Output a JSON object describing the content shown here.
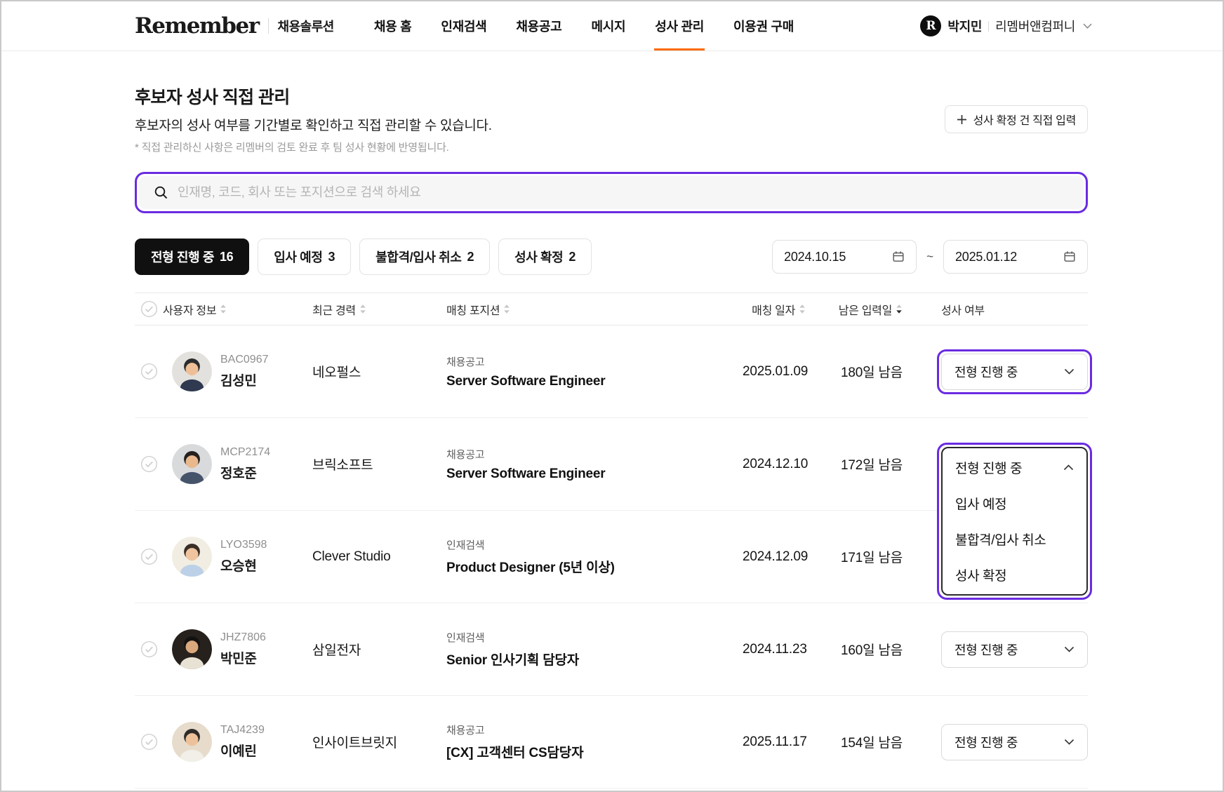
{
  "colors": {
    "accent": "#fa6b0a",
    "highlight": "#6a2be2"
  },
  "icons": {
    "search": "magnifier",
    "calendar": "calendar-range",
    "plus": "plus",
    "chevron_down": "chevron-down",
    "chevron_up": "chevron-up",
    "sort": "up-down-triangles",
    "row_check": "check-circle",
    "logo_mark": "R-circle"
  },
  "nav": {
    "logo": "Remember",
    "product": "채용솔루션",
    "items": [
      {
        "key": "home",
        "label": "채용 홈",
        "active": false
      },
      {
        "key": "talent-search",
        "label": "인재검색",
        "active": false
      },
      {
        "key": "job-postings",
        "label": "채용공고",
        "active": false
      },
      {
        "key": "messages",
        "label": "메시지",
        "active": false
      },
      {
        "key": "match-management",
        "label": "성사 관리",
        "active": true
      },
      {
        "key": "purchase-pass",
        "label": "이용권 구매",
        "active": false
      }
    ],
    "user": {
      "initial": "R",
      "name": "박지민",
      "company": "리멤버앤컴퍼니"
    }
  },
  "page": {
    "title": "후보자 성사 직접 관리",
    "subtitle": "후보자의 성사 여부를 기간별로 확인하고 직접 관리할 수 있습니다.",
    "note": "* 직접 관리하신 사항은 리멤버의 검토 완료 후 팀 성사 현황에 반영됩니다.",
    "add_button_label": "성사 확정 건 직접 입력"
  },
  "search": {
    "placeholder": "인재명, 코드, 회사 또는 포지션으로 검색 하세요"
  },
  "filters": [
    {
      "key": "in-progress",
      "label": "전형 진행 중",
      "count": "16",
      "active": true
    },
    {
      "key": "join-expected",
      "label": "입사 예정",
      "count": "3",
      "active": false
    },
    {
      "key": "rejected-cancelled",
      "label": "불합격/입사 취소",
      "count": "2",
      "active": false
    },
    {
      "key": "confirmed",
      "label": "성사 확정",
      "count": "2",
      "active": false
    }
  ],
  "date_range": {
    "start": "2024.10.15",
    "separator": "~",
    "end": "2025.01.12"
  },
  "table": {
    "columns": [
      {
        "key": "user-info",
        "label": "사용자 정보",
        "sortable": true,
        "sort": null
      },
      {
        "key": "recent-career",
        "label": "최근 경력",
        "sortable": true,
        "sort": null
      },
      {
        "key": "match-position",
        "label": "매칭 포지션",
        "sortable": true,
        "sort": null
      },
      {
        "key": "match-date",
        "label": "매칭 일자",
        "sortable": true,
        "sort": null
      },
      {
        "key": "days-remaining",
        "label": "남은 입력일",
        "sortable": true,
        "sort": "desc"
      },
      {
        "key": "match-status",
        "label": "성사 여부",
        "sortable": false,
        "sort": null
      }
    ],
    "rows": [
      {
        "code": "BAC0967",
        "name": "김성민",
        "company": "네오펄스",
        "source": "채용공고",
        "position": "Server Software Engineer",
        "match_date": "2025.01.09",
        "days_left": "180일 남음",
        "status": "전형 진행 중",
        "status_ui": "dropdown",
        "highlighted": true,
        "avatar": {
          "bg": "#e3e1dd",
          "hair": "#2b2b2e",
          "skin": "#eebf97",
          "shirt": "#2f3a50"
        }
      },
      {
        "code": "MCP2174",
        "name": "정호준",
        "company": "브릭소프트",
        "source": "채용공고",
        "position": "Server Software Engineer",
        "match_date": "2024.12.10",
        "days_left": "172일 남음",
        "status": "전형 진행 중",
        "status_ui": "dropdown-open",
        "highlighted": true,
        "avatar": {
          "bg": "#d9dadc",
          "hair": "#23201e",
          "skin": "#e9b88d",
          "shirt": "#46546a"
        }
      },
      {
        "code": "LYO3598",
        "name": "오승현",
        "company": "Clever Studio",
        "source": "인재검색",
        "position": "Product Designer (5년 이상)",
        "match_date": "2024.12.09",
        "days_left": "171일 남음",
        "status": "",
        "status_ui": "none",
        "highlighted": false,
        "avatar": {
          "bg": "#f1ede2",
          "hair": "#3a2e28",
          "skin": "#f0c49e",
          "shirt": "#bcd1e8"
        }
      },
      {
        "code": "JHZ7806",
        "name": "박민준",
        "company": "삼일전자",
        "source": "인재검색",
        "position": "Senior 인사기획 담당자",
        "match_date": "2024.11.23",
        "days_left": "160일 남음",
        "status": "전형 진행 중",
        "status_ui": "dropdown",
        "highlighted": false,
        "avatar": {
          "bg": "#26211c",
          "hair": "#141210",
          "skin": "#d9a87d",
          "shirt": "#e8e2d4"
        }
      },
      {
        "code": "TAJ4239",
        "name": "이예린",
        "company": "인사이트브릿지",
        "source": "채용공고",
        "position": "[CX] 고객센터 CS담당자",
        "match_date": "2025.11.17",
        "days_left": "154일 남음",
        "status": "전형 진행 중",
        "status_ui": "dropdown",
        "highlighted": false,
        "avatar": {
          "bg": "#e7dccb",
          "hair": "#2e2a28",
          "skin": "#edc19a",
          "shirt": "#f2efe8"
        }
      }
    ]
  },
  "status_dropdown": {
    "selected": "전형 진행 중",
    "options": [
      "입사 예정",
      "불합격/입사 취소",
      "성사 확정"
    ]
  }
}
